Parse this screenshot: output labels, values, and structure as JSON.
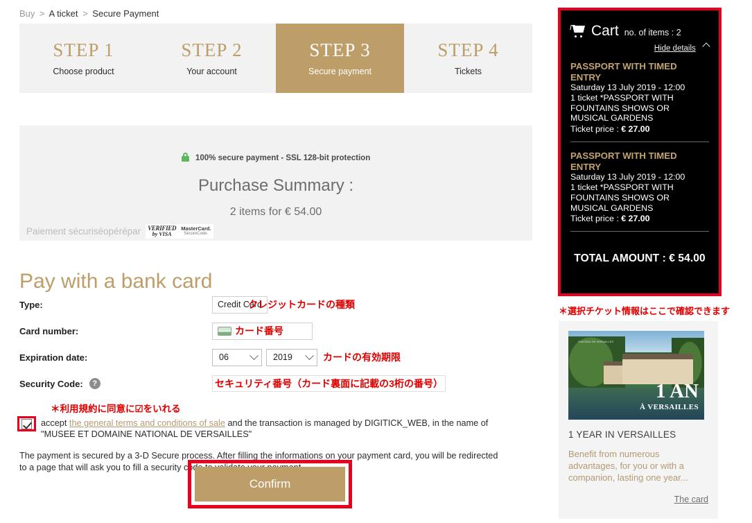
{
  "breadcrumb": {
    "root": "Buy",
    "sep1": ">",
    "item1": "A ticket",
    "sep2": ">",
    "item2": "Secure Payment"
  },
  "stepper": {
    "steps": [
      {
        "title": "STEP 1",
        "sub": "Choose product",
        "active": false
      },
      {
        "title": "STEP 2",
        "sub": "Your account",
        "active": false
      },
      {
        "title": "STEP 3",
        "sub": "Secure payment",
        "active": true
      },
      {
        "title": "STEP 4",
        "sub": "Tickets",
        "active": false
      }
    ]
  },
  "summary": {
    "ssl_text": "100% secure payment - SSL 128-bit protection",
    "title": "Purchase Summary :",
    "items_line": "2 items for € 54.00",
    "secured_by": "Paiement sécuriséopérépar",
    "visa_line1": "VERIFIED",
    "visa_line2": "by VISA",
    "mc_line1": "MasterCard.",
    "mc_line2": "SecureCode."
  },
  "payment": {
    "heading": "Pay with a bank card",
    "type": {
      "label": "Type:",
      "value": "Credit Card",
      "note": "クレジットカードの種類"
    },
    "card_number": {
      "label": "Card number:",
      "value": "",
      "note": "カード番号"
    },
    "expiration": {
      "label": "Expiration date:",
      "month": "06",
      "year": "2019",
      "note": "カードの有効期限"
    },
    "security_code": {
      "label": "Security Code:",
      "help_icon": "question-mark",
      "note": "セキュリティ番号（カード裏面に記載の3桁の番号）"
    }
  },
  "terms": {
    "jp_note": "＊利用規約に同意に☑をいれる",
    "checkbox_checked": true,
    "text_before": "accept",
    "link": "the general terms and conditions of sale",
    "text_after": "and the transaction is managed by DIGITICK_WEB, in the name of \"MUSEE ET DOMAINE NATIONAL DE VERSAILLES\"",
    "secure_note": "The payment is secured by a 3-D Secure process. After filling the informations on your payment card, you will be redirected to a page that will ask you to fill a security code to validate your payment."
  },
  "confirm_button": {
    "label": "Confirm"
  },
  "cart": {
    "icon": "shopping-cart-icon",
    "title": "Cart",
    "count_label": "no. of items : 2",
    "hide_details": "Hide details",
    "items": [
      {
        "name": "PASSPORT WITH TIMED ENTRY",
        "date": "Saturday 13 July 2019 - 12:00",
        "desc": "1 ticket *PASSPORT WITH FOUNTAINS SHOWS OR MUSICAL GARDENS",
        "price_label": "Ticket price : ",
        "price": "€ 27.00"
      },
      {
        "name": "PASSPORT WITH TIMED ENTRY",
        "date": "Saturday 13 July 2019 - 12:00",
        "desc": "1 ticket *PASSPORT WITH FOUNTAINS SHOWS OR MUSICAL GARDENS",
        "price_label": "Ticket price : ",
        "price": "€ 27.00"
      }
    ],
    "total": "TOTAL AMOUNT : € 54.00"
  },
  "right_note": "＊選択チケット情報はここで確認できます",
  "promo": {
    "image_caption_small": "CHATEAU DE VERSAILLES",
    "image_badge_1": "1 AN",
    "image_badge_2": "À VERSAILLES",
    "title": "1 YEAR IN VERSAILLES",
    "description": "Benefit from numerous advantages, for you or with a companion, lasting one year...",
    "link": "The card"
  },
  "colors": {
    "gold": "#bd9d68",
    "gold_text": "#c3a46d",
    "highlight_red": "#e8001c",
    "annotation_red": "#e10000",
    "panel_gray": "#f2f2f2",
    "cart_bg": "#000000",
    "link_gold": "#b39a72"
  }
}
